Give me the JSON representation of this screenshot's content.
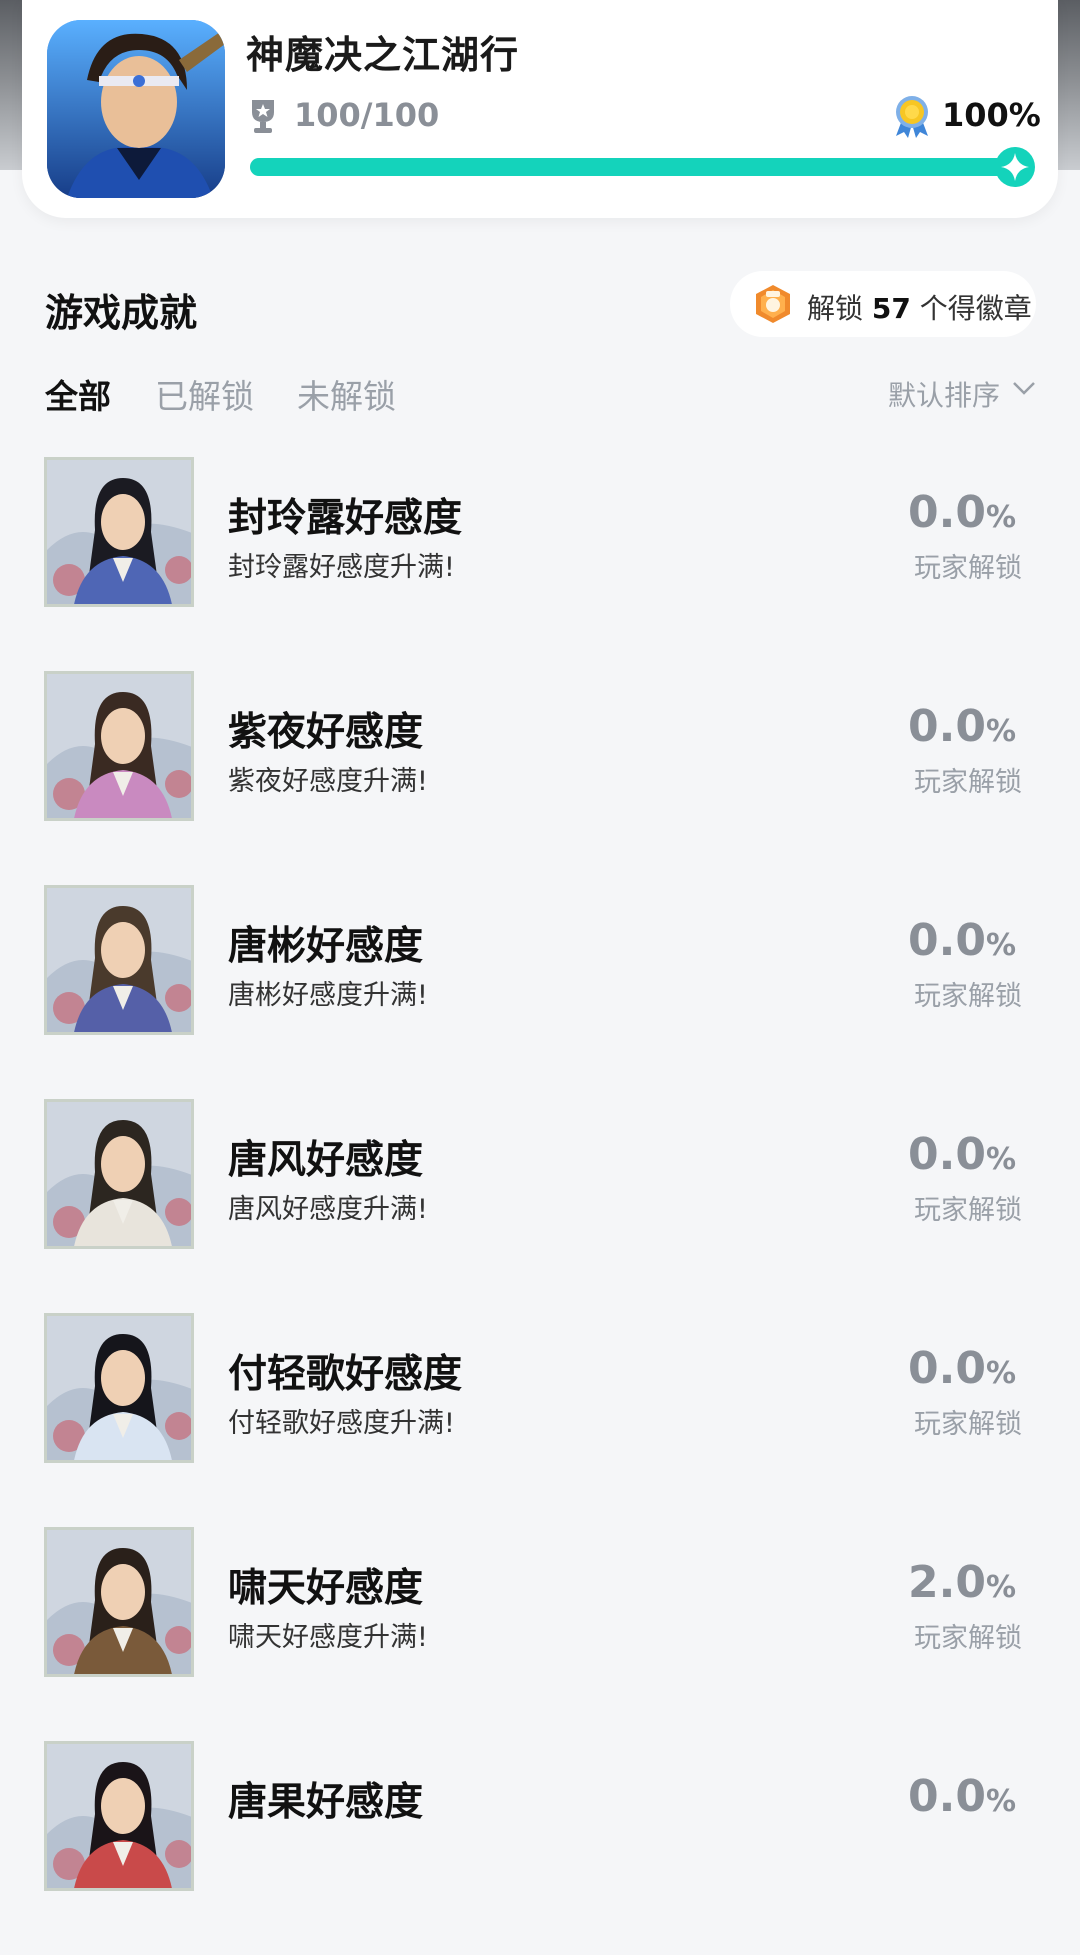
{
  "game": {
    "title": "神魔决之江湖行",
    "score": "100/100",
    "completion": "100%",
    "completion_value": 1.0,
    "accent_color": "#14d3bb",
    "icon": "game-character-icon"
  },
  "section": {
    "title": "游戏成就",
    "badge_prefix": "解锁",
    "badge_count": "57",
    "badge_suffix": "个得徽章"
  },
  "tabs": [
    {
      "label": "全部",
      "active": true
    },
    {
      "label": "已解锁",
      "active": false
    },
    {
      "label": "未解锁",
      "active": false
    }
  ],
  "sort": {
    "label": "默认排序"
  },
  "achievements": [
    {
      "title": "封玲露好感度",
      "desc": "封玲露好感度升满!",
      "rate": "0.0",
      "unit": "%",
      "unlock_label": "玩家解锁",
      "robe": "#4f66b5",
      "hair": "#1b1b22"
    },
    {
      "title": "紫夜好感度",
      "desc": "紫夜好感度升满!",
      "rate": "0.0",
      "unit": "%",
      "unlock_label": "玩家解锁",
      "robe": "#c98ac0",
      "hair": "#3a2a22"
    },
    {
      "title": "唐彬好感度",
      "desc": "唐彬好感度升满!",
      "rate": "0.0",
      "unit": "%",
      "unlock_label": "玩家解锁",
      "robe": "#5560a8",
      "hair": "#4a3a2c"
    },
    {
      "title": "唐风好感度",
      "desc": "唐风好感度升满!",
      "rate": "0.0",
      "unit": "%",
      "unlock_label": "玩家解锁",
      "robe": "#e8e4dc",
      "hair": "#2c2620"
    },
    {
      "title": "付轻歌好感度",
      "desc": "付轻歌好感度升满!",
      "rate": "0.0",
      "unit": "%",
      "unlock_label": "玩家解锁",
      "robe": "#d9e4f2",
      "hair": "#15151b"
    },
    {
      "title": "啸天好感度",
      "desc": "啸天好感度升满!",
      "rate": "2.0",
      "unit": "%",
      "unlock_label": "玩家解锁",
      "robe": "#7a5a3a",
      "hair": "#2a201a"
    },
    {
      "title": "唐果好感度",
      "desc": "",
      "rate": "0.0",
      "unit": "%",
      "unlock_label": "",
      "robe": "#c94a4a",
      "hair": "#1a1418"
    }
  ]
}
